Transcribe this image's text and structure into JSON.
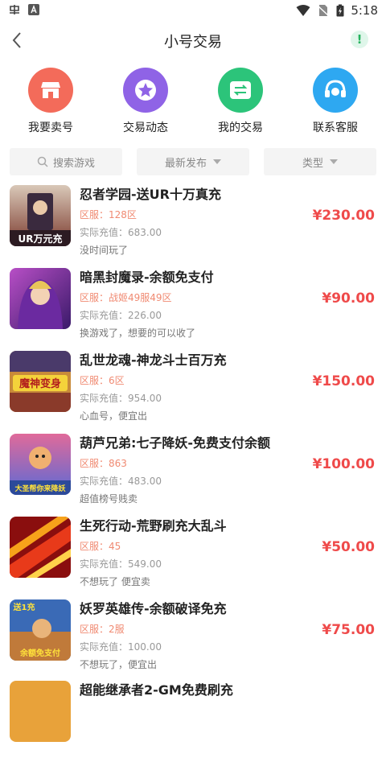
{
  "status_bar": {
    "time": "5:18",
    "left_icons": [
      "app-icon",
      "font-icon"
    ],
    "right_icons": [
      "wifi-icon",
      "no-sim-icon",
      "battery-charging-icon"
    ]
  },
  "nav": {
    "title": "小号交易",
    "alert_symbol": "!"
  },
  "quick_actions": [
    {
      "label": "我要卖号",
      "icon": "store-icon",
      "color": "#f36b5a"
    },
    {
      "label": "交易动态",
      "icon": "star-icon",
      "color": "#8f63e6"
    },
    {
      "label": "我的交易",
      "icon": "exchange-icon",
      "color": "#2cc47a"
    },
    {
      "label": "联系客服",
      "icon": "headset-icon",
      "color": "#2ea8f1"
    }
  ],
  "filters": {
    "search_placeholder": "搜索游戏",
    "sort_label": "最新发布",
    "type_label": "类型"
  },
  "listings": [
    {
      "name": "忍者学园-送UR十万真充",
      "server": "区服：128区",
      "recharge": "实际充值：683.00",
      "note": "没时间玩了",
      "price": "¥230.00"
    },
    {
      "name": "暗黑封魔录-余额免支付",
      "server": "区服：战姬49服49区",
      "recharge": "实际充值：226.00",
      "note": "换游戏了，想要的可以收了",
      "price": "¥90.00"
    },
    {
      "name": "乱世龙魂-神龙斗士百万充",
      "server": "区服：6区",
      "recharge": "实际充值：954.00",
      "note": "心血号，便宜出",
      "price": "¥150.00"
    },
    {
      "name": "葫芦兄弟:七子降妖-免费支付余额",
      "server": "区服：863",
      "recharge": "实际充值：483.00",
      "note": "超值榜号贱卖",
      "price": "¥100.00"
    },
    {
      "name": "生死行动-荒野刷充大乱斗",
      "server": "区服：45",
      "recharge": "实际充值：549.00",
      "note": "不想玩了 便宜卖",
      "price": "¥50.00"
    },
    {
      "name": "妖罗英雄传-余额破译免充",
      "server": "区服：2服",
      "recharge": "实际充值：100.00",
      "note": "不想玩了，便宜出",
      "price": "¥75.00"
    },
    {
      "name": "超能继承者2-GM免费刷充",
      "server": "",
      "recharge": "",
      "note": "",
      "price": ""
    }
  ],
  "thumb_texts": [
    "UR万元充",
    "魔神变身",
    "大圣帮你来降妖",
    "送1充",
    "余额免支付"
  ]
}
